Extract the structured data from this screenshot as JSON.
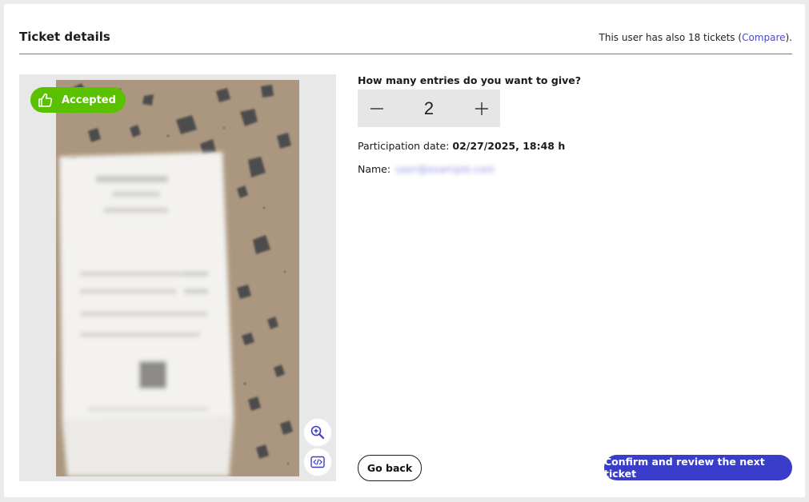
{
  "header": {
    "title": "Ticket details",
    "tickets_note_prefix": "This user has also 18 tickets (",
    "compare_link": "Compare",
    "tickets_note_suffix": ")."
  },
  "image": {
    "status_label": "Accepted",
    "status_icon": "thumbs-up-icon",
    "zoom_icon": "zoom-in-icon",
    "code_icon": "code-view-icon"
  },
  "entries": {
    "question": "How many entries do you want to give?",
    "value": "2"
  },
  "participation": {
    "label": "Participation date:",
    "value": "02/27/2025, 18:48 h"
  },
  "name": {
    "label": "Name:",
    "value": "user@example.com"
  },
  "actions": {
    "back_label": "Go back",
    "confirm_label": "Confirm and review the next ticket"
  },
  "colors": {
    "accepted": "#59c100",
    "primary": "#3a3dca",
    "link": "#4b49c9"
  }
}
